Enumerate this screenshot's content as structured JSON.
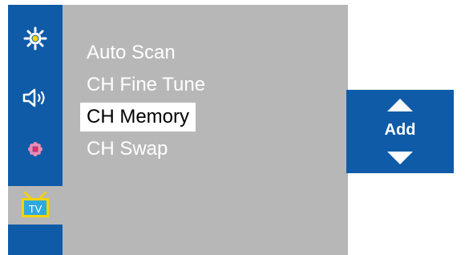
{
  "sidebar": {
    "items": [
      {
        "icon": "picture-settings-icon"
      },
      {
        "icon": "sound-icon"
      },
      {
        "icon": "setup-icon"
      },
      {
        "icon": "tv-channel-icon",
        "label": "TV",
        "selected": true
      }
    ]
  },
  "menu": {
    "items": [
      {
        "label": "Auto Scan",
        "selected": false
      },
      {
        "label": "CH Fine Tune",
        "selected": false
      },
      {
        "label": "CH Memory",
        "selected": true
      },
      {
        "label": "CH Swap",
        "selected": false
      }
    ]
  },
  "value_selector": {
    "value": "Add",
    "up_icon": "triangle-up-icon",
    "down_icon": "triangle-down-icon"
  },
  "colors": {
    "accent_blue": "#0f5ba8",
    "panel_gray": "#b7b7b7",
    "highlight": "#ffffff",
    "tv_icon_yellow": "#f5d400",
    "tv_icon_screen": "#2fa8e0"
  }
}
